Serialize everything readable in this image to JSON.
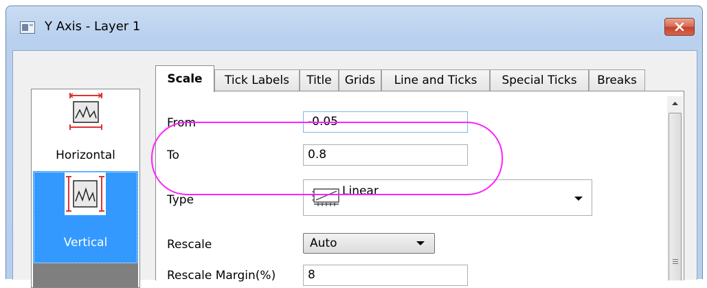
{
  "window": {
    "title": "Y Axis - Layer 1"
  },
  "sidebar": {
    "items": [
      {
        "label": "Horizontal",
        "icon": "horizontal-axis-icon",
        "selected": false
      },
      {
        "label": "Vertical",
        "icon": "vertical-axis-icon",
        "selected": true
      }
    ]
  },
  "tabs": [
    "Scale",
    "Tick Labels",
    "Title",
    "Grids",
    "Line and Ticks",
    "Special Ticks",
    "Breaks"
  ],
  "active_tab": "Scale",
  "form": {
    "from_label": "From",
    "from_value": "-0.05",
    "to_label": "To",
    "to_value": "0.8",
    "type_label": "Type",
    "type_value": "Linear",
    "rescale_label": "Rescale",
    "rescale_value": "Auto",
    "rescale_margin_label": "Rescale Margin(%)",
    "rescale_margin_value": "8"
  },
  "colors": {
    "selection": "#3399ff",
    "highlight_ring": "#ff1fff",
    "close_button": "#c4432a"
  }
}
